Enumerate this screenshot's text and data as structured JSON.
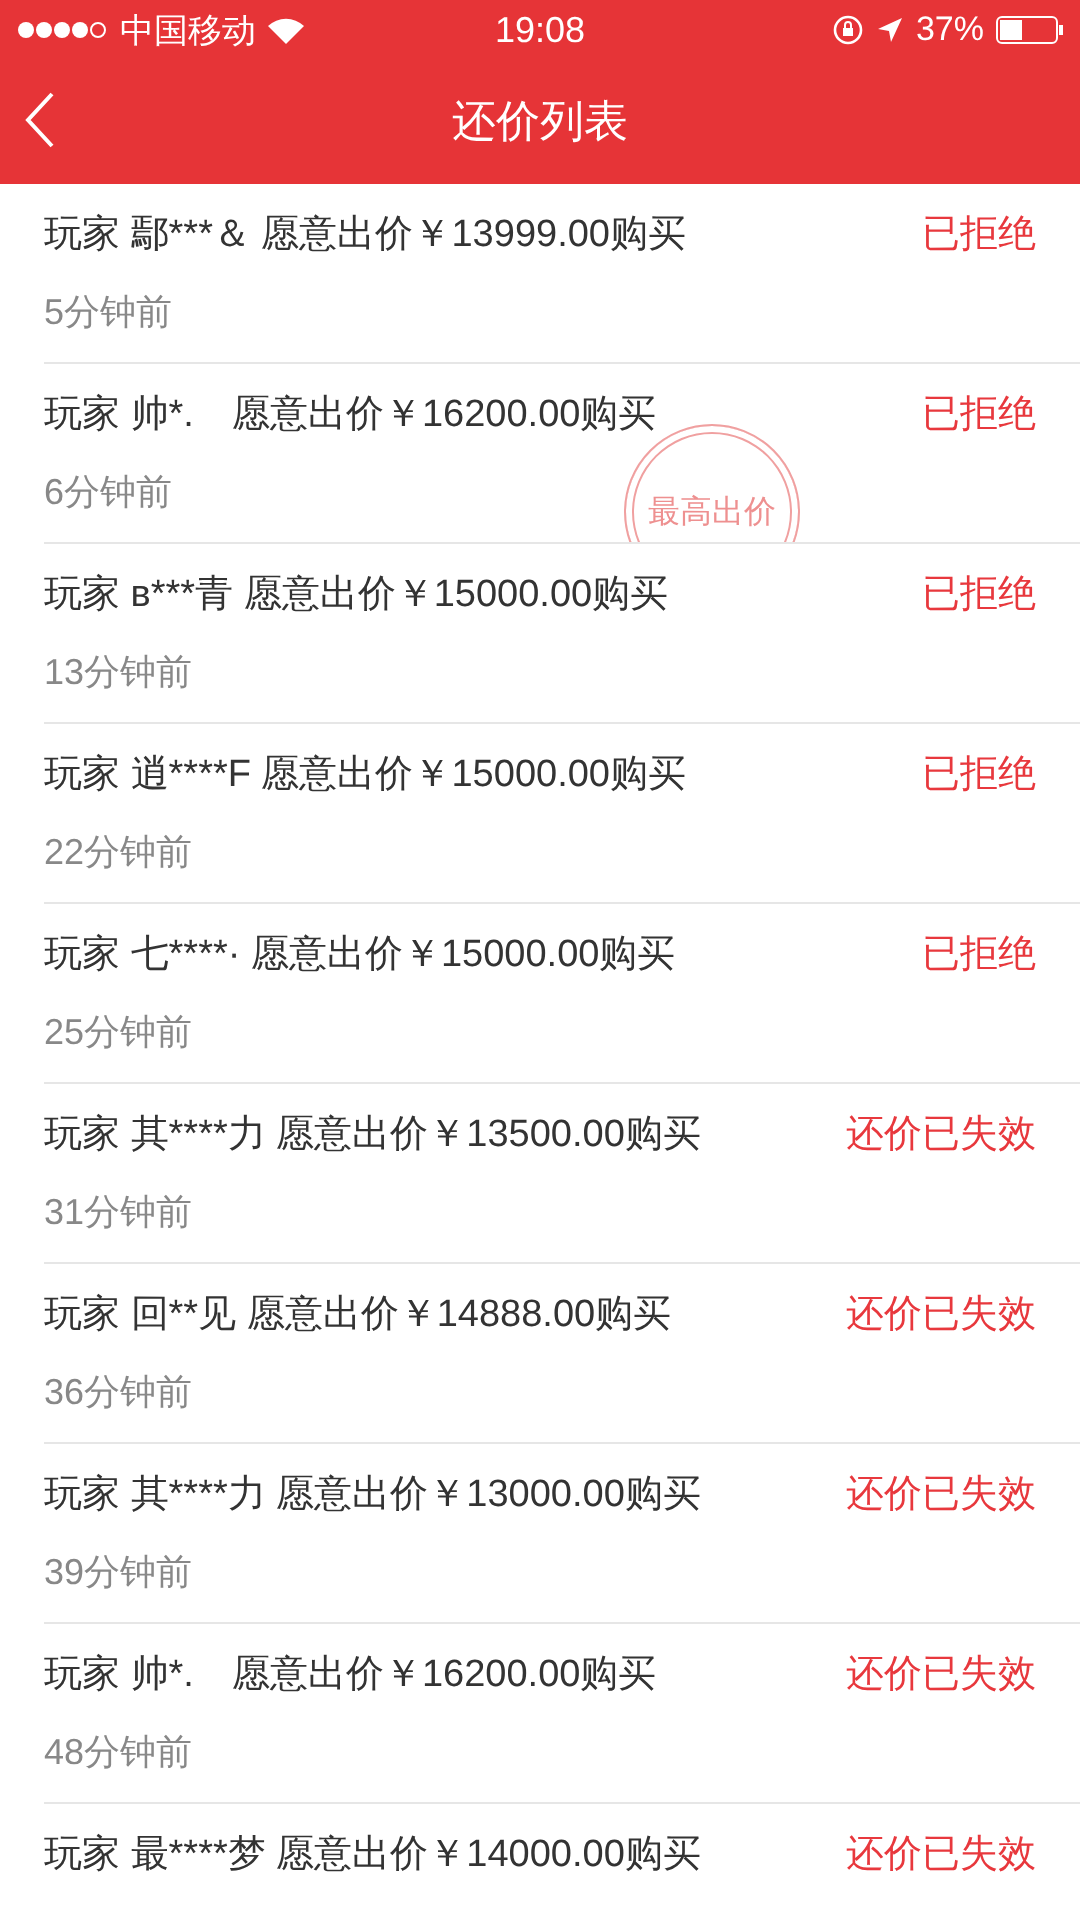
{
  "status_bar": {
    "carrier": "中国移动",
    "time": "19:08",
    "battery": "37%"
  },
  "nav": {
    "title": "还价列表"
  },
  "offers": [
    {
      "text": "玩家 鄢***＆ 愿意出价￥13999.00购买",
      "time": "5分钟前",
      "status": "已拒绝"
    },
    {
      "text": "玩家 帅*.　愿意出价￥16200.00购买",
      "time": "6分钟前",
      "status": "已拒绝",
      "stamp": "最高出价"
    },
    {
      "text": "玩家 в***青 愿意出价￥15000.00购买",
      "time": "13分钟前",
      "status": "已拒绝"
    },
    {
      "text": "玩家 逍****F 愿意出价￥15000.00购买",
      "time": "22分钟前",
      "status": "已拒绝"
    },
    {
      "text": "玩家 七****· 愿意出价￥15000.00购买",
      "time": "25分钟前",
      "status": "已拒绝"
    },
    {
      "text": "玩家 其****力 愿意出价￥13500.00购买",
      "time": "31分钟前",
      "status": "还价已失效"
    },
    {
      "text": "玩家 回**见 愿意出价￥14888.00购买",
      "time": "36分钟前",
      "status": "还价已失效"
    },
    {
      "text": "玩家 其****力 愿意出价￥13000.00购买",
      "time": "39分钟前",
      "status": "还价已失效"
    },
    {
      "text": "玩家 帅*.　愿意出价￥16200.00购买",
      "time": "48分钟前",
      "status": "还价已失效"
    },
    {
      "text": "玩家 最****梦 愿意出价￥14000.00购买",
      "status": "还价已失效"
    }
  ]
}
